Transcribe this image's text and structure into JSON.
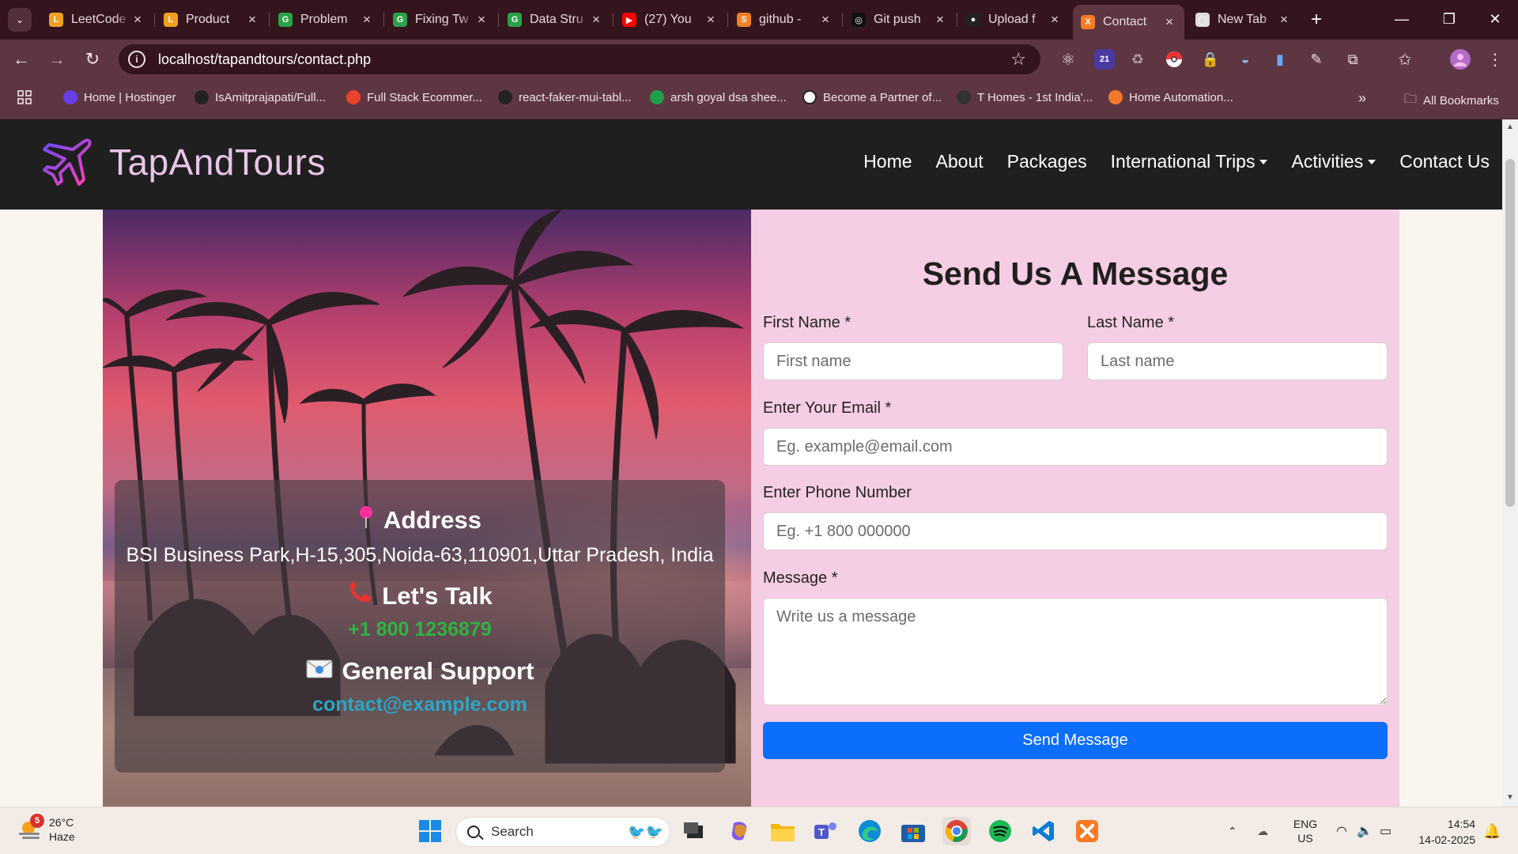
{
  "browser": {
    "tabs": [
      {
        "title": "LeetCode",
        "fav_color": "#f0a020",
        "fav_glyph": "L",
        "icon": "leetcode-icon"
      },
      {
        "title": "Product",
        "fav_color": "#f0a020",
        "fav_glyph": "L",
        "icon": "leetcode-icon"
      },
      {
        "title": "Problem",
        "fav_color": "#2ca148",
        "fav_glyph": "G",
        "icon": "geeksforgeeks-icon"
      },
      {
        "title": "Fixing Tw",
        "fav_color": "#2ca148",
        "fav_glyph": "G",
        "icon": "geeksforgeeks-icon"
      },
      {
        "title": "Data Stru",
        "fav_color": "#2ca148",
        "fav_glyph": "G",
        "icon": "geeksforgeeks-icon"
      },
      {
        "title": "(27) You",
        "fav_color": "#ff0000",
        "fav_glyph": "▶",
        "icon": "youtube-icon"
      },
      {
        "title": "github -",
        "fav_color": "#f48024",
        "fav_glyph": "S",
        "icon": "stackoverflow-icon"
      },
      {
        "title": "Git push",
        "fav_color": "#111111",
        "fav_glyph": "◎",
        "icon": "openai-icon"
      },
      {
        "title": "Upload f",
        "fav_color": "#222222",
        "fav_glyph": "●",
        "icon": "github-icon"
      },
      {
        "title": "Contact",
        "fav_color": "#fb7a24",
        "fav_glyph": "X",
        "icon": "xampp-icon",
        "active": true
      },
      {
        "title": "New Tab",
        "fav_color": "#dddddd",
        "fav_glyph": "◯",
        "icon": "chrome-icon"
      }
    ],
    "url": "localhost/tapandtours/contact.php",
    "bookmarks": [
      {
        "label": "Home | Hostinger",
        "color": "#673de6",
        "icon": "hostinger-icon"
      },
      {
        "label": "IsAmitprajapati/Full...",
        "color": "#222222",
        "icon": "github-icon"
      },
      {
        "label": "Full Stack Ecommer...",
        "color": "#e8412c",
        "icon": "bookmark-red-icon"
      },
      {
        "label": "react-faker-mui-tabl...",
        "color": "#222222",
        "icon": "github-icon"
      },
      {
        "label": "arsh goyal dsa shee...",
        "color": "#1e9e4a",
        "icon": "sheets-icon"
      },
      {
        "label": "Become a Partner of...",
        "color": "#ffffff",
        "icon": "partner-icon"
      },
      {
        "label": "T Homes - 1st India'...",
        "color": "#333333",
        "icon": "thomes-icon"
      },
      {
        "label": "Home Automation...",
        "color": "#f07a2a",
        "icon": "home-automation-icon"
      }
    ],
    "all_bookmarks": "All Bookmarks"
  },
  "site": {
    "brand": "TapAndTours",
    "nav": [
      "Home",
      "About",
      "Packages",
      "International Trips",
      "Activities",
      "Contact Us"
    ],
    "contact": {
      "address_title": "Address",
      "address": "BSI Business Park,H-15,305,Noida-63,110901,Uttar Pradesh, India",
      "talk_title": "Let's Talk",
      "phone": "+1 800 1236879",
      "support_title": "General Support",
      "email": "contact@example.com"
    },
    "form": {
      "title": "Send Us A Message",
      "first_name_label": "First Name *",
      "first_name_placeholder": "First name",
      "last_name_label": "Last Name *",
      "last_name_placeholder": "Last name",
      "email_label": "Enter Your Email *",
      "email_placeholder": "Eg. example@email.com",
      "phone_label": "Enter Phone Number",
      "phone_placeholder": "Eg. +1 800 000000",
      "message_label": "Message *",
      "message_placeholder": "Write us a message",
      "submit": "Send Message"
    }
  },
  "taskbar": {
    "weather_temp": "26°C",
    "weather_desc": "Haze",
    "weather_badge": "5",
    "search_label": "Search",
    "lang": "ENG",
    "region": "US",
    "time": "14:54",
    "date": "14-02-2025",
    "extension_badge": "21"
  }
}
